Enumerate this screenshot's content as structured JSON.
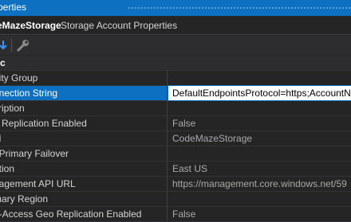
{
  "window": {
    "title": "perties"
  },
  "object_bar": {
    "name": "eMazeStorage",
    "type": "Storage Account Properties"
  },
  "toolbar": {
    "icons": [
      "sort-down-icon",
      "wrench-icon"
    ]
  },
  "category": {
    "label": "c"
  },
  "properties": [
    {
      "label": "nity Group",
      "value": ""
    },
    {
      "label": "nnection String",
      "value": "DefaultEndpointsProtocol=https;AccountName",
      "selected": true
    },
    {
      "label": "cription",
      "value": ""
    },
    {
      "label": "o Replication Enabled",
      "value": "False"
    },
    {
      "label": "el",
      "value": "CodeMazeStorage"
    },
    {
      "label": "t Primary Failover",
      "value": ""
    },
    {
      "label": "ation",
      "value": "East US"
    },
    {
      "label": "nagement API URL",
      "value": "https://management.core.windows.net/59"
    },
    {
      "label": "mary Region",
      "value": ""
    },
    {
      "label": "d-Access Geo Replication Enabled",
      "value": "False"
    }
  ],
  "colors": {
    "accent": "#0e70c0",
    "background": "#252526"
  }
}
